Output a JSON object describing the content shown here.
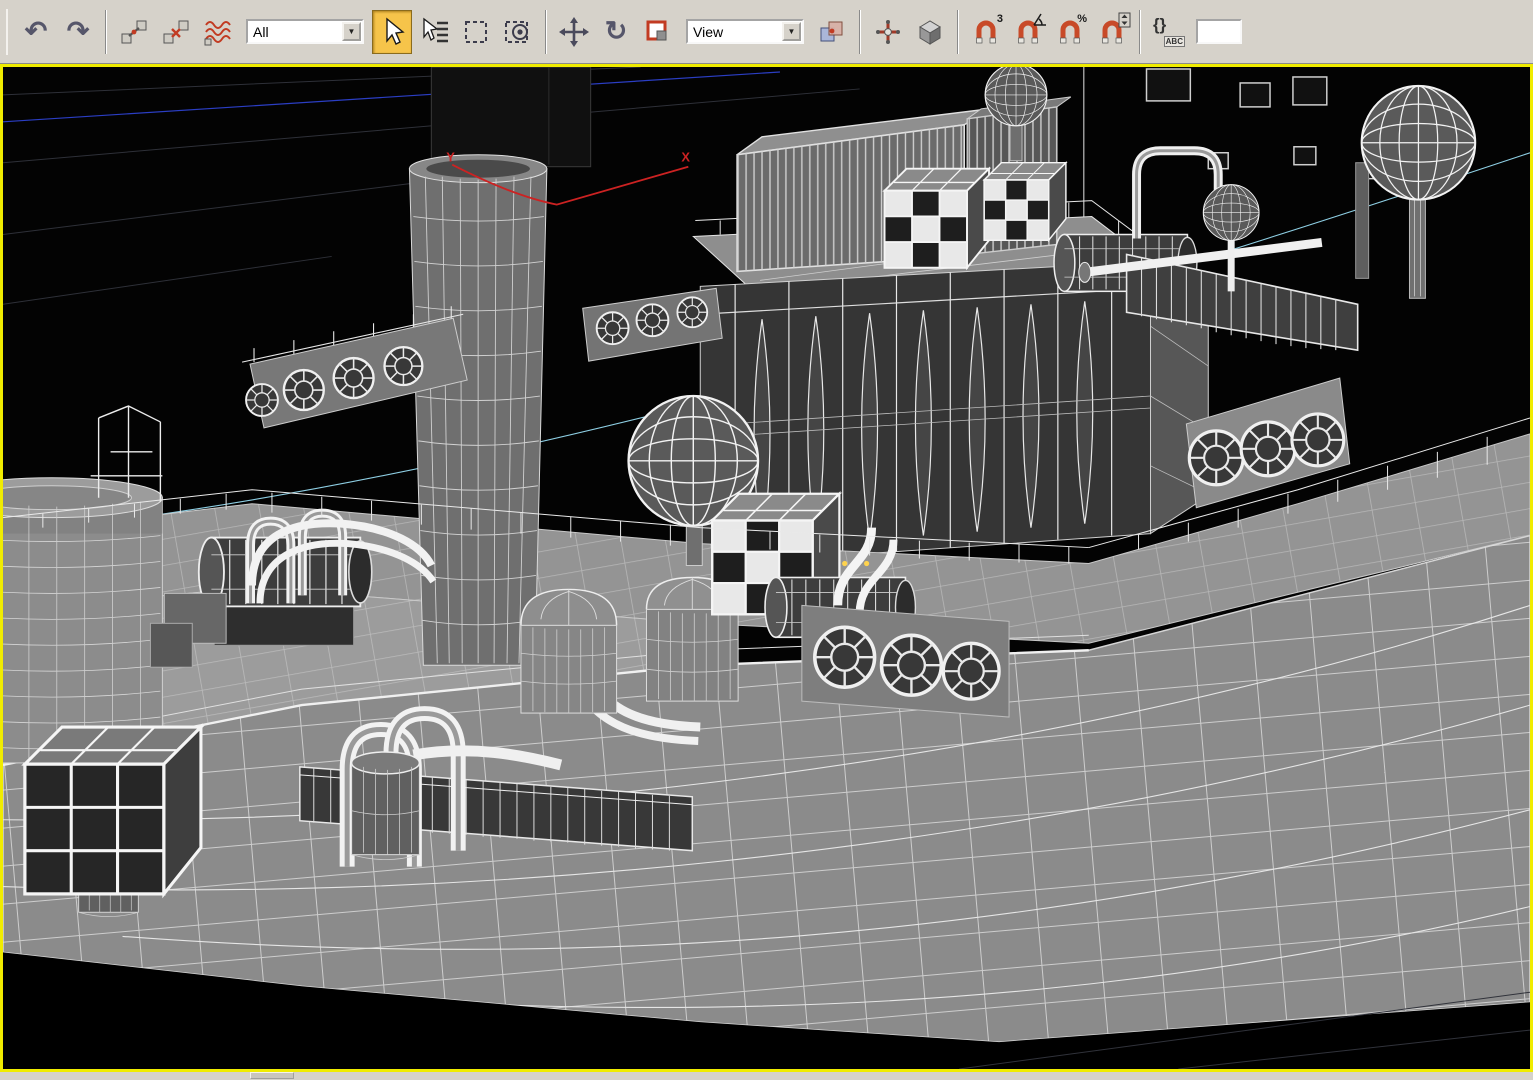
{
  "toolbar": {
    "undo_icon": "↶",
    "redo_icon": "↷",
    "rotate_icon": "↻",
    "selection_filter": {
      "value": "All",
      "arrow": "▼"
    },
    "ref_coord": {
      "value": "View",
      "arrow": "▼"
    },
    "snaps": {
      "count_label": "3",
      "percent_label": "%"
    },
    "named_sets": {
      "braces_label": "{}",
      "abc_label": "ABC"
    }
  },
  "viewport": {
    "axis_labels": {
      "y": "Y",
      "x": "X"
    },
    "border_color": "#f0ec00",
    "background": "#000000"
  },
  "colors": {
    "toolbar_background": "#d6d2ca",
    "active_tool_highlight": "#f6c44a",
    "magnet_red": "#c84a28",
    "axis_label_red": "#cc2222",
    "wireframe_white": "#f0f0f0",
    "hull_gray": "#8b8b8b"
  }
}
